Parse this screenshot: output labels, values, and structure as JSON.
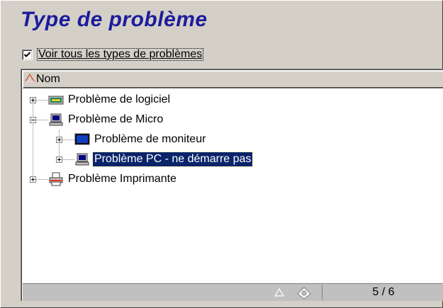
{
  "window": {
    "title": "Type de problème"
  },
  "filter": {
    "checkbox_label": "Voir tous les types de problèmes",
    "checked": true
  },
  "list": {
    "column_header": "Nom",
    "items": [
      {
        "label": "Problème de logiciel",
        "level": 0,
        "expanded": false,
        "icon": "software-icon",
        "selected": false
      },
      {
        "label": "Problème de Micro",
        "level": 0,
        "expanded": true,
        "icon": "computer-icon",
        "selected": false
      },
      {
        "label": "Problème de moniteur",
        "level": 1,
        "expanded": false,
        "icon": "monitor-icon",
        "selected": false
      },
      {
        "label": "Problème PC - ne démarre pas",
        "level": 1,
        "expanded": false,
        "icon": "computer-icon",
        "selected": true
      },
      {
        "label": "Problème Imprimante",
        "level": 0,
        "expanded": false,
        "icon": "printer-icon",
        "selected": false
      }
    ]
  },
  "status": {
    "counter": "5 / 6"
  },
  "colors": {
    "title": "#1c1c9c",
    "selection": "#0a246a",
    "panel": "#d4d0c8"
  }
}
